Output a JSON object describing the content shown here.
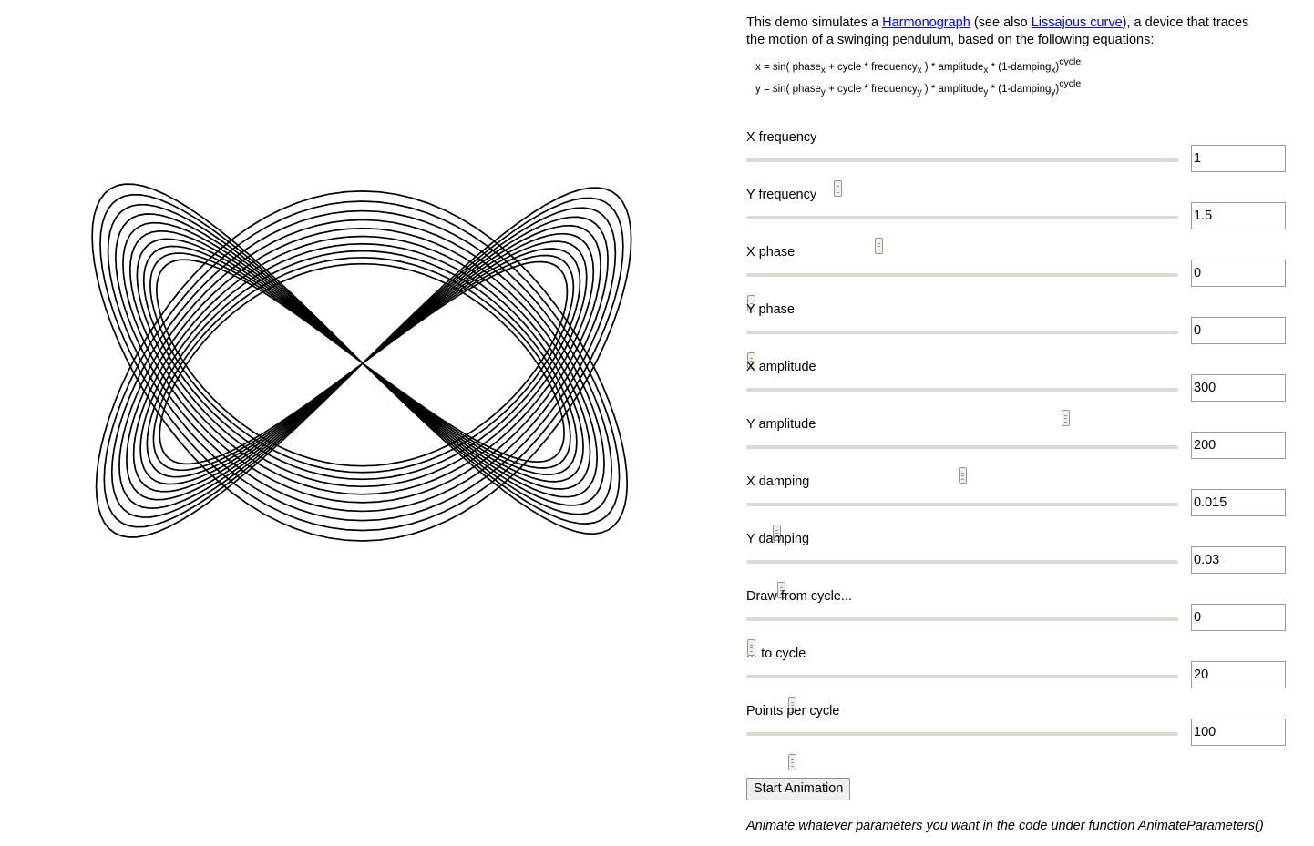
{
  "intro": {
    "text_before": "This demo simulates a ",
    "link_harmonograph": "Harmonograph",
    "text_middle": " (see also ",
    "link_lissajous": "Lissajous curve",
    "text_after": "), a device that traces the motion of a swinging pendulum, based on the following equations:"
  },
  "equations": {
    "x": {
      "prefix": "x = sin( phase",
      "sub1": "x",
      "mid1": " + cycle * frequency",
      "sub2": "x",
      "mid2": " ) * amplitude",
      "sub3": "x",
      "mid3": " * (1-damping",
      "sub4": "x",
      "close": ")",
      "sup": "cycle"
    },
    "y": {
      "prefix": "y = sin( phase",
      "sub1": "y",
      "mid1": " + cycle * frequency",
      "sub2": "y",
      "mid2": " ) * amplitude",
      "sub3": "y",
      "mid3": " * (1-damping",
      "sub4": "y",
      "close": ")",
      "sup": "cycle"
    }
  },
  "controls": [
    {
      "label": "X frequency",
      "value": "1",
      "slider_fraction": 0.205
    },
    {
      "label": "Y frequency",
      "value": "1.5",
      "slider_fraction": 0.303
    },
    {
      "label": "X phase",
      "value": "0",
      "slider_fraction": 0.0
    },
    {
      "label": "Y phase",
      "value": "0",
      "slider_fraction": 0.0
    },
    {
      "label": "X amplitude",
      "value": "300",
      "slider_fraction": 0.745
    },
    {
      "label": "Y amplitude",
      "value": "200",
      "slider_fraction": 0.5
    },
    {
      "label": "X damping",
      "value": "0.015",
      "slider_fraction": 0.06
    },
    {
      "label": "Y damping",
      "value": "0.03",
      "slider_fraction": 0.072
    },
    {
      "label": "Draw from cycle...",
      "value": "0",
      "slider_fraction": 0.0
    },
    {
      "label": "... to cycle",
      "value": "20",
      "slider_fraction": 0.098
    },
    {
      "label": "Points per cycle",
      "value": "100",
      "slider_fraction": 0.098
    }
  ],
  "start_button": "Start Animation",
  "note": "Animate whatever parameters you want in the code under function AnimateParameters()",
  "colors": {
    "curve": "#000000",
    "link": "#0000ee",
    "slider_track": "#dcd8d2"
  }
}
